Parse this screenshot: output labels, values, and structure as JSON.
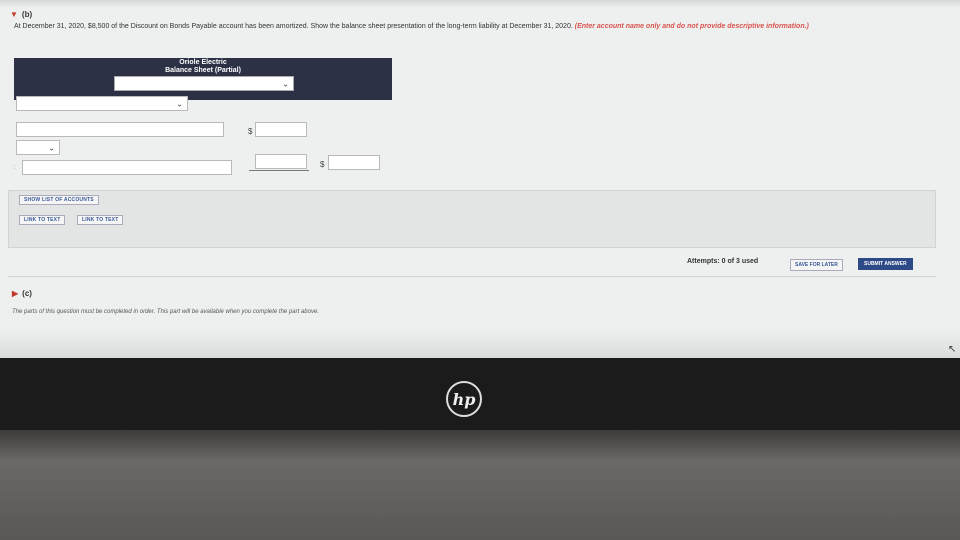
{
  "part_b": {
    "label": "(b)",
    "instruction": "At December 31, 2020, $8,500 of the Discount on Bonds Payable account has been amortized. Show the balance sheet presentation of the long-term liability at December 31, 2020.",
    "instruction_note": "(Enter account name only and do not provide descriptive information.)"
  },
  "balance_sheet": {
    "company": "Oriole Electric",
    "title": "Balance Sheet (Partial)"
  },
  "form": {
    "dollar_1": "$",
    "dollar_2": "$",
    "row_marker": ":"
  },
  "buttons": {
    "show_list": "SHOW LIST OF ACCOUNTS",
    "link_text_1": "LINK TO TEXT",
    "link_text_2": "LINK TO TEXT",
    "save_later": "SAVE FOR LATER",
    "submit": "SUBMIT ANSWER"
  },
  "attempts": "Attempts: 0 of 3 used",
  "part_c": {
    "label": "(c)",
    "note": "The parts of this question must be completed in order. This part will be available when you complete the part above."
  },
  "laptop": {
    "logo": "hp"
  },
  "icons": {
    "expand": "triangle-down-icon",
    "collapse": "triangle-right-icon",
    "dropdown": "chevron-down-icon"
  },
  "colors": {
    "header_bg": "#2c3146",
    "submit_bg": "#2e4b88",
    "instruction_accent": "#d9534f"
  }
}
